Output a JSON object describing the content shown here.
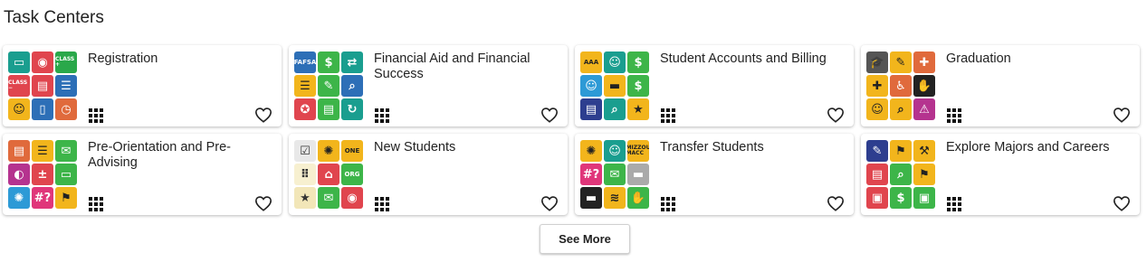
{
  "page": {
    "title": "Task Centers"
  },
  "cards": [
    {
      "title": "Registration",
      "icons": [
        {
          "name": "computer-icon",
          "color": "#1a9e8f",
          "glyph": "▭"
        },
        {
          "name": "camera-icon",
          "color": "#e0454e",
          "glyph": "◉"
        },
        {
          "name": "class-add-icon",
          "color": "#2aa84a",
          "glyph": "CLASS +"
        },
        {
          "name": "class-remove-icon",
          "color": "#e0454e",
          "glyph": "CLASS −"
        },
        {
          "name": "calendar-icon",
          "color": "#e0454e",
          "glyph": "▤"
        },
        {
          "name": "checklist-icon",
          "color": "#2d6fb7",
          "glyph": "☰"
        },
        {
          "name": "person-icon",
          "color": "#f2b51c",
          "glyph": "☺"
        },
        {
          "name": "document-icon",
          "color": "#2d6fb7",
          "glyph": "▯"
        },
        {
          "name": "clock-icon",
          "color": "#e06a3c",
          "glyph": "◷"
        }
      ]
    },
    {
      "title": "Financial Aid and Financial Success",
      "icons": [
        {
          "name": "fafsa-icon",
          "color": "#2d6fb7",
          "glyph": "FAFSA"
        },
        {
          "name": "money-document-icon",
          "color": "#3db549",
          "glyph": "$"
        },
        {
          "name": "money-exchange-icon",
          "color": "#1a9e8f",
          "glyph": "⇄"
        },
        {
          "name": "list-icon",
          "color": "#f2b51c",
          "glyph": "☰"
        },
        {
          "name": "tutoring-icon",
          "color": "#3db549",
          "glyph": "✎"
        },
        {
          "name": "money-search-icon",
          "color": "#2d6fb7",
          "glyph": "⌕"
        },
        {
          "name": "award-icon",
          "color": "#e0454e",
          "glyph": "✪"
        },
        {
          "name": "form-icon",
          "color": "#3db549",
          "glyph": "▤"
        },
        {
          "name": "money-refresh-icon",
          "color": "#1a9e8f",
          "glyph": "↻"
        }
      ]
    },
    {
      "title": "Student Accounts and Billing",
      "icons": [
        {
          "name": "aaa-icon",
          "color": "#f2b51c",
          "glyph": "AAA"
        },
        {
          "name": "user-account-icon",
          "color": "#1a9e8f",
          "glyph": "☺"
        },
        {
          "name": "bill-icon",
          "color": "#3db549",
          "glyph": "$"
        },
        {
          "name": "user-money-icon",
          "color": "#2d9ad6",
          "glyph": "☺"
        },
        {
          "name": "tiger-card-icon",
          "color": "#f2b51c",
          "glyph": "▬"
        },
        {
          "name": "money-icon",
          "color": "#3db549",
          "glyph": "$"
        },
        {
          "name": "statement-icon",
          "color": "#2d3e8f",
          "glyph": "▤"
        },
        {
          "name": "document-search-icon",
          "color": "#1a9e8f",
          "glyph": "⌕"
        },
        {
          "name": "star-icon",
          "color": "#f2b51c",
          "glyph": "★"
        }
      ]
    },
    {
      "title": "Graduation",
      "icons": [
        {
          "name": "graduation-cap-icon",
          "color": "#555555",
          "glyph": "🎓"
        },
        {
          "name": "diploma-icon",
          "color": "#f2b51c",
          "glyph": "✎"
        },
        {
          "name": "bandage-icon",
          "color": "#e06a3c",
          "glyph": "✚"
        },
        {
          "name": "bandage-alt-icon",
          "color": "#f2b51c",
          "glyph": "✚"
        },
        {
          "name": "accessibility-icon",
          "color": "#e06a3c",
          "glyph": "♿"
        },
        {
          "name": "handshake-icon",
          "color": "#222222",
          "glyph": "✋"
        },
        {
          "name": "person-alt-icon",
          "color": "#f2b51c",
          "glyph": "☺"
        },
        {
          "name": "document-review-icon",
          "color": "#f2b51c",
          "glyph": "⌕"
        },
        {
          "name": "warning-calendar-icon",
          "color": "#b5338f",
          "glyph": "⚠"
        }
      ]
    },
    {
      "title": "Pre-Orientation and Pre-Advising",
      "icons": [
        {
          "name": "schedule-icon",
          "color": "#e06a3c",
          "glyph": "▤"
        },
        {
          "name": "checklist-alt-icon",
          "color": "#f2b51c",
          "glyph": "☰"
        },
        {
          "name": "chat-icon",
          "color": "#3db549",
          "glyph": "✉"
        },
        {
          "name": "palette-icon",
          "color": "#b5338f",
          "glyph": "◐"
        },
        {
          "name": "calculator-icon",
          "color": "#e0454e",
          "glyph": "±"
        },
        {
          "name": "presentation-icon",
          "color": "#3db549",
          "glyph": "▭"
        },
        {
          "name": "tiger-icon",
          "color": "#2d9ad6",
          "glyph": "✺"
        },
        {
          "name": "hashtag-icon",
          "color": "#e0367a",
          "glyph": "#?"
        },
        {
          "name": "flag-icon",
          "color": "#f2b51c",
          "glyph": "⚑"
        }
      ]
    },
    {
      "title": "New Students",
      "icons": [
        {
          "name": "document-check-icon",
          "color": "#e8e8e8",
          "glyph": "☑"
        },
        {
          "name": "tiger-alt-icon",
          "color": "#f2b51c",
          "glyph": "✺"
        },
        {
          "name": "one-icon",
          "color": "#f2b51c",
          "glyph": "ONE"
        },
        {
          "name": "braille-icon",
          "color": "#f7f0d0",
          "glyph": "⠿"
        },
        {
          "name": "campus-icon",
          "color": "#e0454e",
          "glyph": "⌂"
        },
        {
          "name": "org-icon",
          "color": "#3db549",
          "glyph": "ORG"
        },
        {
          "name": "star-alt-icon",
          "color": "#f2e6b8",
          "glyph": "★"
        },
        {
          "name": "chat-alt-icon",
          "color": "#3db549",
          "glyph": "✉"
        },
        {
          "name": "calendar-alt-icon",
          "color": "#e0454e",
          "glyph": "◉"
        }
      ]
    },
    {
      "title": "Transfer Students",
      "icons": [
        {
          "name": "tiger-transfer-icon",
          "color": "#f2b51c",
          "glyph": "✺"
        },
        {
          "name": "user-transfer-icon",
          "color": "#1a9e8f",
          "glyph": "☺"
        },
        {
          "name": "mizzou-macc-icon",
          "color": "#f2b51c",
          "glyph": "MIZZOU MACC"
        },
        {
          "name": "hashtag-alt-icon",
          "color": "#e0367a",
          "glyph": "#?"
        },
        {
          "name": "chat-transfer-icon",
          "color": "#3db549",
          "glyph": "✉"
        },
        {
          "name": "transfer-card-icon",
          "color": "#aaaaaa",
          "glyph": "▬"
        },
        {
          "name": "id-card-icon",
          "color": "#222222",
          "glyph": "▬"
        },
        {
          "name": "wifi-icon",
          "color": "#f2b51c",
          "glyph": "≋"
        },
        {
          "name": "hands-icon",
          "color": "#3db549",
          "glyph": "✋"
        }
      ]
    },
    {
      "title": "Explore Majors and Careers",
      "icons": [
        {
          "name": "compass-icon",
          "color": "#2d3e8f",
          "glyph": "✎"
        },
        {
          "name": "flag-alt-icon",
          "color": "#f2b51c",
          "glyph": "⚑"
        },
        {
          "name": "career-tools-icon",
          "color": "#f2b51c",
          "glyph": "⚒"
        },
        {
          "name": "resume-icon",
          "color": "#e0454e",
          "glyph": "▤"
        },
        {
          "name": "briefcase-search-icon",
          "color": "#3db549",
          "glyph": "⌕"
        },
        {
          "name": "flag-career-icon",
          "color": "#f2b51c",
          "glyph": "⚑"
        },
        {
          "name": "briefcase-icon",
          "color": "#e0454e",
          "glyph": "▣"
        },
        {
          "name": "briefcase-money-icon",
          "color": "#3db549",
          "glyph": "$"
        },
        {
          "name": "briefcase-alt-icon",
          "color": "#3db549",
          "glyph": "▣"
        }
      ]
    }
  ],
  "buttons": {
    "see_more": "See More"
  }
}
